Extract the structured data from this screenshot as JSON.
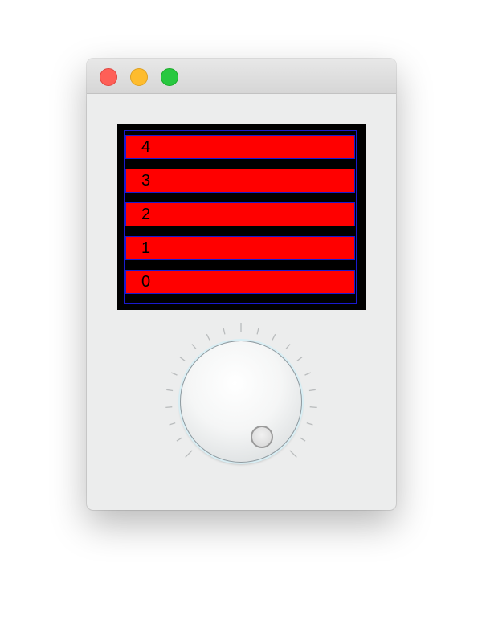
{
  "window": {
    "controls": [
      "close",
      "minimize",
      "zoom"
    ],
    "colors": {
      "close": "#fe5f57",
      "minimize": "#febc2e",
      "zoom": "#28c840"
    }
  },
  "list": {
    "items": [
      {
        "label": "4"
      },
      {
        "label": "3"
      },
      {
        "label": "2"
      },
      {
        "label": "1"
      },
      {
        "label": "0"
      }
    ],
    "colors": {
      "background": "#000000",
      "row": "#ff0000",
      "row_border": "#1a1ad0"
    }
  },
  "dial": {
    "tick_count": 21,
    "handle_icon": "dial-knob-indicator"
  }
}
